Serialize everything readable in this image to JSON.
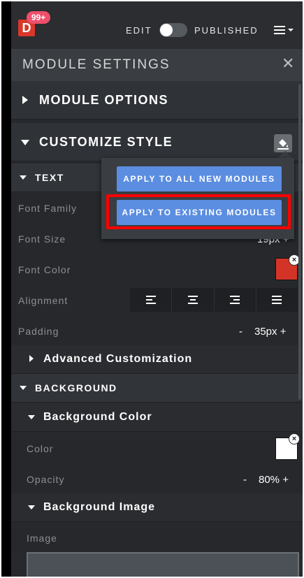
{
  "topbar": {
    "logo_letter": "D",
    "badge": "99+",
    "edit_label": "EDIT",
    "published_label": "PUBLISHED",
    "menu_icon": "hamburger-menu-icon"
  },
  "module_settings": {
    "title": "MODULE SETTINGS",
    "close_icon": "close-icon",
    "sections": {
      "module_options": "MODULE OPTIONS",
      "customize_style": "CUSTOMIZE STYLE"
    }
  },
  "popup": {
    "apply_new": "APPLY TO ALL NEW MODULES",
    "apply_existing": "APPLY TO EXISTING MODULES"
  },
  "text_section": {
    "label": "TEXT",
    "font_family_label": "Font Family",
    "font_size_label": "Font Size",
    "font_size_value": "19px +",
    "font_color_label": "Font Color",
    "font_color": "#d43428",
    "alignment_label": "Alignment",
    "alignment_options": [
      "align-left-icon",
      "align-center-icon",
      "align-right-icon",
      "align-justify-icon"
    ],
    "padding_label": "Padding",
    "padding_minus": "-",
    "padding_value": "35px +",
    "advanced_label": "Advanced Customization"
  },
  "background_section": {
    "label": "BACKGROUND",
    "bg_color_label": "Background Color",
    "color_label": "Color",
    "color_value": "#ffffff",
    "opacity_label": "Opacity",
    "opacity_minus": "-",
    "opacity_value": "80% +",
    "bg_image_label": "Background Image",
    "image_label": "Image"
  }
}
